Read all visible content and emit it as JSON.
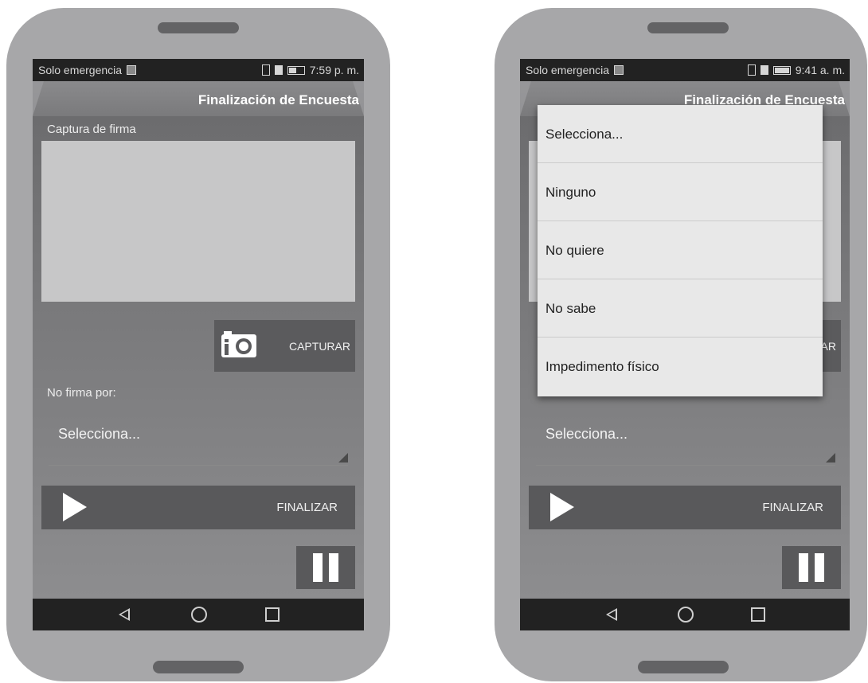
{
  "left_screen": {
    "status": {
      "carrier": "Solo emergencia",
      "time": "7:59 p. m.",
      "battery_level": 0.5
    },
    "title": "Finalización de Encuesta",
    "signature_label": "Captura de firma",
    "capture_label": "CAPTURAR",
    "no_sign_label": "No firma por:",
    "select_value": "Selecciona...",
    "finish_label": "FINALIZAR"
  },
  "right_screen": {
    "status": {
      "carrier": "Solo emergencia",
      "time": "9:41 a. m.",
      "battery_level": 1.0
    },
    "title": "Finalización de Encuesta",
    "capture_label_fragment": "AR",
    "select_value": "Selecciona...",
    "finish_label": "FINALIZAR",
    "dropdown_options": [
      "Selecciona...",
      "Ninguno",
      "No quiere",
      "No sabe",
      "Impedimento físico"
    ]
  },
  "icons": [
    "camera-icon",
    "play-icon",
    "pause-icon",
    "back-icon",
    "home-icon",
    "recents-icon",
    "vibrate-icon",
    "sim-icon",
    "battery-icon"
  ],
  "colors": {
    "screen_bg": "#6f6f71",
    "button_bg": "#59595b",
    "dropdown_bg": "#e8e8e8",
    "phone_body": "#a7a7a9"
  }
}
